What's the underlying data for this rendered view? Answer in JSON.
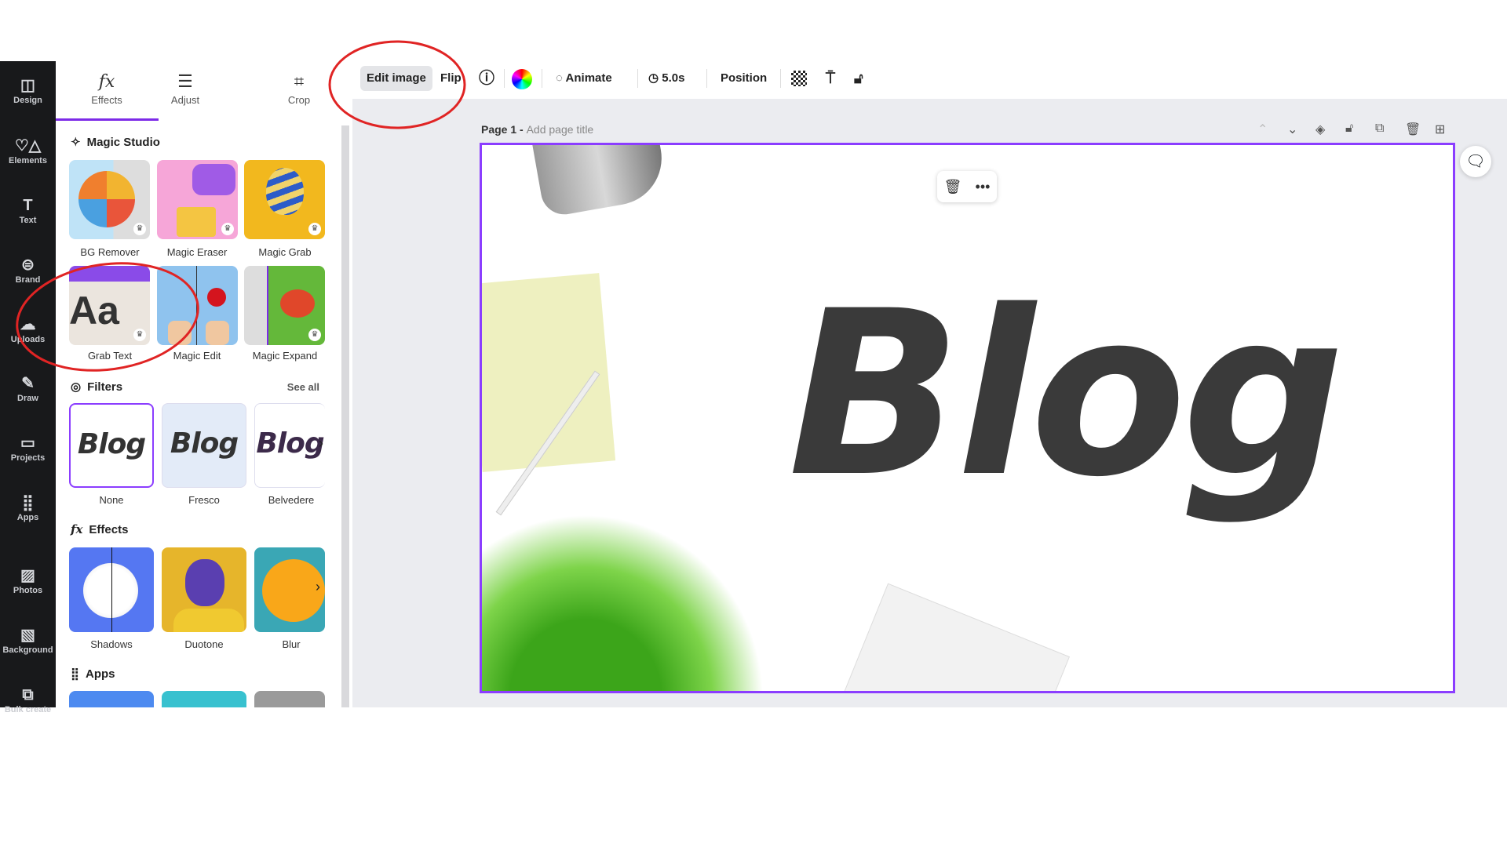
{
  "rail": [
    {
      "label": "Design",
      "icon": "layout-icon"
    },
    {
      "label": "Elements",
      "icon": "shapes-icon"
    },
    {
      "label": "Text",
      "icon": "text-icon"
    },
    {
      "label": "Brand",
      "icon": "brand-icon"
    },
    {
      "label": "Uploads",
      "icon": "cloud-upload-icon"
    },
    {
      "label": "Draw",
      "icon": "pen-icon"
    },
    {
      "label": "Projects",
      "icon": "folder-icon"
    },
    {
      "label": "Apps",
      "icon": "grid-icon"
    },
    {
      "label": "Photos",
      "icon": "image-icon"
    },
    {
      "label": "Background",
      "icon": "hatch-icon"
    },
    {
      "label": "Bulk create",
      "icon": "bulk-icon"
    }
  ],
  "tabs": [
    {
      "label": "Effects",
      "icon": "fx"
    },
    {
      "label": "Adjust",
      "icon": "☰"
    },
    {
      "label": "Crop",
      "icon": "⌗"
    }
  ],
  "magic_studio": {
    "title": "Magic Studio",
    "items": [
      "BG Remover",
      "Magic Eraser",
      "Magic Grab",
      "Grab Text",
      "Magic Edit",
      "Magic Expand"
    ]
  },
  "filters": {
    "title": "Filters",
    "see_all": "See all",
    "items": [
      "None",
      "Fresco",
      "Belvedere"
    ],
    "preview": "Blog"
  },
  "effects": {
    "title": "Effects",
    "items": [
      "Shadows",
      "Duotone",
      "Blur"
    ]
  },
  "apps": {
    "title": "Apps"
  },
  "toolbar": {
    "edit_image": "Edit image",
    "flip": "Flip",
    "animate": "Animate",
    "duration": "5.0s",
    "position": "Position"
  },
  "page": {
    "label": "Page 1 -",
    "title_placeholder": "Add page title",
    "text": "Blog"
  },
  "colors": {
    "accent": "#8b3dff",
    "annotation": "#e02424",
    "rail": "#18191b"
  }
}
